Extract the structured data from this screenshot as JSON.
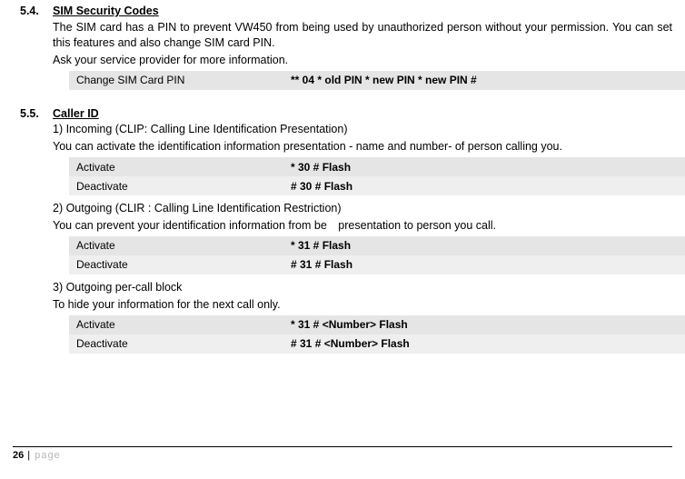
{
  "sections": [
    {
      "number": "5.4.",
      "title": "SIM Security Codes",
      "blocks": [
        {
          "type": "p",
          "justify": true,
          "text": "The SIM card has a PIN to prevent VW450 from being used by unauthorized person without your permission. You can set this features and also change SIM card PIN."
        },
        {
          "type": "p",
          "text": "Ask your service provider for more information."
        },
        {
          "type": "table",
          "single": true,
          "rows": [
            {
              "label": "Change SIM Card PIN",
              "code": "** 04 * old PIN * new PIN * new PIN #"
            }
          ]
        }
      ]
    },
    {
      "number": "5.5.",
      "title": "Caller ID",
      "blocks": [
        {
          "type": "p",
          "text": "1) Incoming (CLIP: Calling Line Identification Presentation)"
        },
        {
          "type": "p",
          "text": "You can activate the identification information presentation - name and number- of person calling you."
        },
        {
          "type": "table",
          "rows": [
            {
              "label": "Activate",
              "code": "* 30 # Flash"
            },
            {
              "label": "Deactivate",
              "code": "# 30 # Flash"
            }
          ]
        },
        {
          "type": "p",
          "text": "2) Outgoing (CLIR : Calling Line Identification Restriction)"
        },
        {
          "type": "p",
          "text": "You can prevent your identification information from be presentation to person you call."
        },
        {
          "type": "table",
          "rows": [
            {
              "label": "Activate",
              "code": "* 31 # Flash"
            },
            {
              "label": "Deactivate",
              "code": "# 31 # Flash"
            }
          ]
        },
        {
          "type": "p",
          "text": "3) Outgoing per-call block"
        },
        {
          "type": "p",
          "text": "To hide your information for the next call only."
        },
        {
          "type": "table",
          "rows": [
            {
              "label": "Activate",
              "code": "* 31 # <Number> Flash"
            },
            {
              "label": "Deactivate",
              "code": "# 31 # <Number> Flash"
            }
          ]
        }
      ]
    }
  ],
  "footer": {
    "page_number": "26",
    "sep": " | ",
    "label": "page"
  }
}
